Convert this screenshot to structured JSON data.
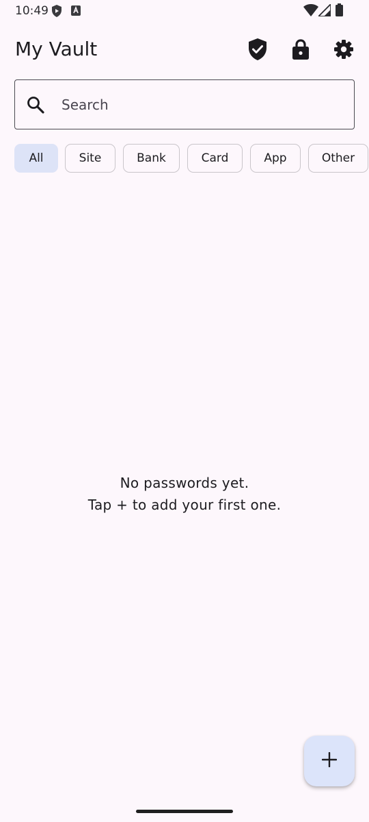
{
  "status_bar": {
    "time": "10:49"
  },
  "app_bar": {
    "title": "My Vault",
    "actions": [
      "shield-check-icon",
      "lock-icon",
      "gear-icon"
    ]
  },
  "search": {
    "placeholder": "Search",
    "value": ""
  },
  "filters": {
    "selected": "All",
    "chips": [
      "All",
      "Site",
      "Bank",
      "Card",
      "App",
      "Other"
    ]
  },
  "empty_state": {
    "line1": "No passwords yet.",
    "line2": "Tap + to add your first one."
  },
  "fab": {
    "icon": "plus-icon"
  },
  "colors": {
    "background": "#fdf7fc",
    "chip_selected": "#dde3f7",
    "fab": "#dce4fa",
    "text": "#1c1b1f"
  }
}
